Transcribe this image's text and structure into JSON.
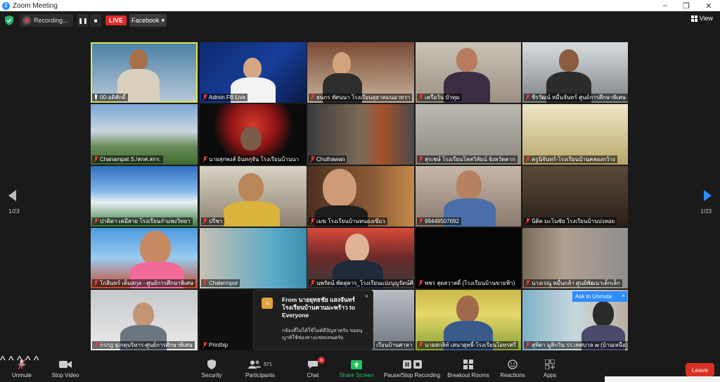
{
  "window": {
    "title": "Zoom Meeting"
  },
  "topbar": {
    "recording_label": "Recording...",
    "live_label": "LIVE",
    "stream_target": "Facebook",
    "view_label": "View"
  },
  "gallery": {
    "page_left": "1/23",
    "page_right": "1/23",
    "tiles": [
      {
        "name": "00-อดิศักดิ์",
        "muted": false
      },
      {
        "name": "Admin FB Live",
        "muted": true
      },
      {
        "name": "ธนกร ทัศนนา โรงเรียนสุธาคมนอาทวา",
        "muted": true
      },
      {
        "name": "เครือวัน บัวทุม",
        "muted": true
      },
      {
        "name": "ชีรวัฒน์ หมื่นจันทร์ ศูนย์การศึกษาพิเศษ",
        "muted": true
      },
      {
        "name": "Chanampat S./สกศ.สกร.",
        "muted": true
      },
      {
        "name": "นายสุกพงส์ อินทกุจัน โรงเรียนบ้านนา",
        "muted": true
      },
      {
        "name": "Chuthawan",
        "muted": true
      },
      {
        "name": "สุรเชษ์ โรงเรียนโคสวิลัยน์ จังหวัดตาก",
        "muted": true
      },
      {
        "name": "ครูนิจันทร์-โรงเรียนบ้านคลองกว้าง",
        "muted": true
      },
      {
        "name": "ปาติดา เคมีสาย โรงเรียนกำแพงวิทยา",
        "muted": true
      },
      {
        "name": "ปรีชา",
        "muted": true
      },
      {
        "name": "เมฆ โรงเรียนบ้านหนองเขียว",
        "muted": true
      },
      {
        "name": "99449507692",
        "muted": true
      },
      {
        "name": "นิติต มะโนชัย โรงเรียนบ้านปงหอย",
        "muted": true
      },
      {
        "name": "โกสินทร์ เต็มสกุล - ศูนย์การศึกษาพิเศษ",
        "muted": true
      },
      {
        "name": "Chalermpol",
        "muted": true
      },
      {
        "name": "นพรัตน์ พัดสุคาร_โรงเรียนแบ่งบุญรัตน์ศึกษา",
        "muted": true
      },
      {
        "name": "พชร สุดสวาสดิ์ (โรงเรียนบ้านขายฟ้า)",
        "muted": true
      },
      {
        "name": "นางเรณู หมื่นกล้า ศูนย์พัฒนาเด็กเล็ก",
        "muted": true
      },
      {
        "name": "กรกฎ ฐูเกตุบริหาร-ศูนย์การศึกษาพิเศษ",
        "muted": true
      },
      {
        "name": "Printhip",
        "muted": true
      },
      {
        "name": "เรียนบ้านศาลา",
        "muted": false
      },
      {
        "name": "นายสกลิท์ เสนาดุทธิ์-โรงเรียนโอทรศรี",
        "muted": true
      },
      {
        "name": "สุทิดา มูสิกวิน รร.เทศบาล ๗ (บ้านเหนือ)",
        "muted": true
      }
    ]
  },
  "chat_toast": {
    "avatar_text": "น",
    "from_text": "From นายยุทธชัย แสงจันทร์ โรงเรียนบ้านควนมะพร้าว to Everyone",
    "message": "กล้องที่ไม่ได้ใช้ไมค์มีปัญหาครับ ขออนุญาติใช้ช่องทางแชทแทนครับ",
    "close": "×"
  },
  "unmute_tip": {
    "label": "Ask to Unmute",
    "close": "×"
  },
  "toolbar": {
    "unmute": "Unmute",
    "stop_video": "Stop Video",
    "security": "Security",
    "participants": "Participants",
    "participants_count": "571",
    "chat": "Chat",
    "chat_badge": "6",
    "share_screen": "Share Screen",
    "recording": "Pause/Stop Recording",
    "breakout": "Breakout Rooms",
    "reactions": "Reactions",
    "apps": "Apps",
    "leave": "Leave"
  },
  "colors": {
    "accent": "#2d8cff",
    "live": "#e02828",
    "leave": "#d93025",
    "share": "#22c45e",
    "active_speaker": "#d7e84a"
  }
}
